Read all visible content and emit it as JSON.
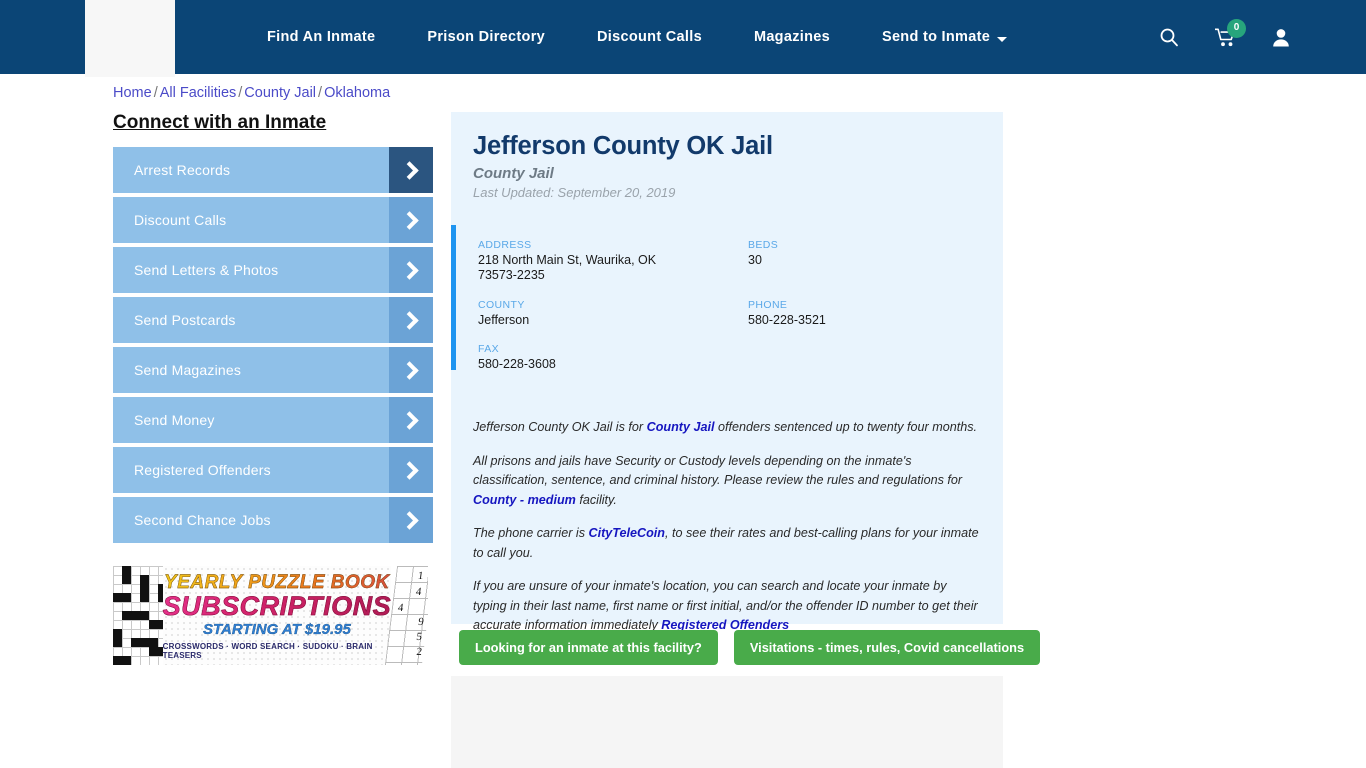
{
  "navbar": {
    "logo_alt": "site-logo",
    "links": [
      {
        "label": "Find An Inmate",
        "dropdown": false
      },
      {
        "label": "Prison Directory",
        "dropdown": false
      },
      {
        "label": "Discount Calls",
        "dropdown": false
      },
      {
        "label": "Magazines",
        "dropdown": false
      },
      {
        "label": "Send to Inmate",
        "dropdown": true
      }
    ],
    "search_icon": "search-icon",
    "cart_icon": "shopping-cart-icon",
    "cart_count": "0",
    "account_icon": "user-account-icon",
    "bg_color": "#0b4576",
    "badge_color": "#27a57c"
  },
  "breadcrumb": {
    "items": [
      "Home",
      "All Facilities",
      "County Jail",
      "Oklahoma"
    ],
    "separator": "/"
  },
  "sidebar": {
    "title": "Connect with an Inmate",
    "items": [
      {
        "label": "Arrest Records",
        "active": true
      },
      {
        "label": "Discount Calls",
        "active": false
      },
      {
        "label": "Send Letters & Photos",
        "active": false
      },
      {
        "label": "Send Postcards",
        "active": false
      },
      {
        "label": "Send Magazines",
        "active": false
      },
      {
        "label": "Send Money",
        "active": false
      },
      {
        "label": "Registered Offenders",
        "active": false
      },
      {
        "label": "Second Chance Jobs",
        "active": false
      }
    ],
    "button_color": "#8fc0e8",
    "arrow_color": "#6ba3d6",
    "arrow_active_color": "#2b5580"
  },
  "ad": {
    "line1": "YEARLY PUZZLE BOOK",
    "line2": "SUBSCRIPTIONS",
    "line3": "STARTING AT $19.95",
    "line4": "CROSSWORDS · WORD SEARCH · SUDOKU · BRAIN TEASERS",
    "sudoku_numbers": [
      "1",
      "4",
      "4",
      "9",
      "5",
      "2"
    ]
  },
  "facility": {
    "title": "Jefferson County OK Jail",
    "subtitle": "County Jail",
    "last_updated": "Last Updated: September 20, 2019",
    "info": [
      {
        "label": "ADDRESS",
        "value": "218 North Main St, Waurika, OK 73573-2235"
      },
      {
        "label": "BEDS",
        "value": "30"
      },
      {
        "label": "COUNTY",
        "value": "Jefferson"
      },
      {
        "label": "PHONE",
        "value": "580-228-3521"
      },
      {
        "label": "FAX",
        "value": "580-228-3608"
      }
    ],
    "accent_color": "#1e94f0",
    "card_color": "#e9f4fd",
    "paragraphs": [
      {
        "parts": [
          {
            "text": "Jefferson County OK Jail is for ",
            "link": false
          },
          {
            "text": "County Jail",
            "link": true
          },
          {
            "text": " offenders sentenced up to twenty four months.",
            "link": false
          }
        ]
      },
      {
        "parts": [
          {
            "text": "All prisons and jails have Security or Custody levels depending on the inmate's classification, sentence, and criminal history. Please review the rules and regulations for ",
            "link": false
          },
          {
            "text": "County - medium",
            "link": true
          },
          {
            "text": " facility.",
            "link": false
          }
        ]
      },
      {
        "parts": [
          {
            "text": "The phone carrier is ",
            "link": false
          },
          {
            "text": "CityTeleCoin",
            "link": true
          },
          {
            "text": ", to see their rates and best-calling plans for your inmate to call you.",
            "link": false
          }
        ]
      },
      {
        "parts": [
          {
            "text": "If you are unsure of your inmate's location, you can search and locate your inmate by typing in their last name, first name or first initial, and/or the offender ID number to get their accurate information immediately ",
            "link": false
          },
          {
            "text": "Registered Offenders",
            "link": true
          }
        ]
      }
    ]
  },
  "cta": {
    "buttons": [
      {
        "label": "Looking for an inmate at this facility?"
      },
      {
        "label": "Visitations - times, rules, Covid cancellations"
      }
    ],
    "color": "#49ab4a"
  }
}
